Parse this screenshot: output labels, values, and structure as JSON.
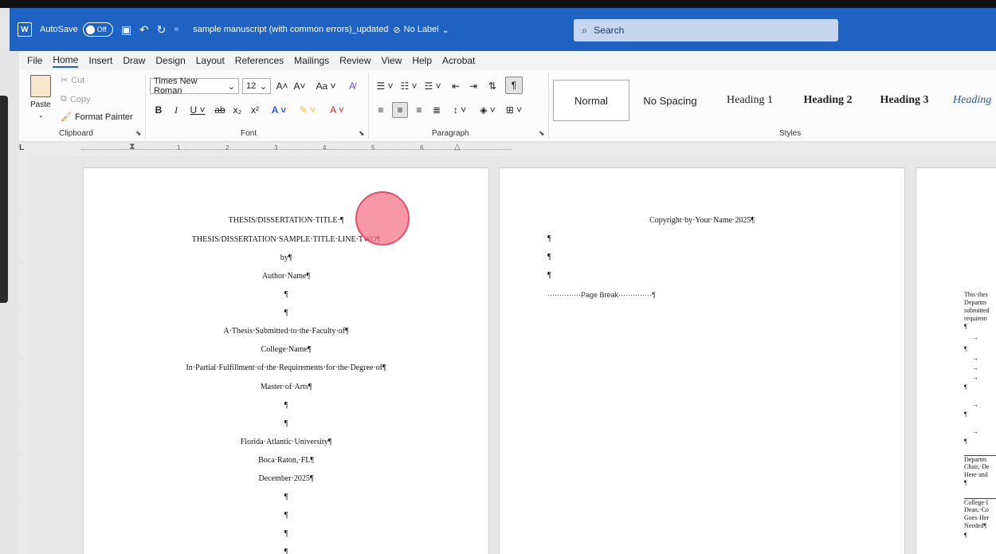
{
  "titlebar": {
    "autosave_label": "AutoSave",
    "autosave_state": "Off",
    "doc_title": "sample manuscript (with common errors)_updated",
    "sensitivity_label": "No Label",
    "search_placeholder": "Search"
  },
  "tabs": [
    "File",
    "Home",
    "Insert",
    "Draw",
    "Design",
    "Layout",
    "References",
    "Mailings",
    "Review",
    "View",
    "Help",
    "Acrobat"
  ],
  "active_tab": "Home",
  "clipboard": {
    "paste": "Paste",
    "cut": "Cut",
    "copy": "Copy",
    "format_painter": "Format Painter",
    "group_label": "Clipboard"
  },
  "font": {
    "family": "Times New Roman",
    "size": "12",
    "group_label": "Font"
  },
  "paragraph": {
    "group_label": "Paragraph"
  },
  "styles": {
    "group_label": "Styles",
    "items": [
      "Normal",
      "No Spacing",
      "Heading 1",
      "Heading 2",
      "Heading 3",
      "Heading"
    ]
  },
  "ruler": {
    "marks": [
      "1",
      "2",
      "3",
      "4",
      "5",
      "6"
    ]
  },
  "page1": {
    "lines": [
      "THESIS/DISSERTATION·TITLE·¶",
      "THESIS/DISSERTATION·SAMPLE·TITLE·LINE·TWO¶",
      "by¶",
      "Author·Name¶",
      "¶",
      "¶",
      "A·Thesis·Submitted·to·the·Faculty·of¶",
      "College·Name¶",
      "In·Partial·Fulfillment·of·the·Requirements·for·the·Degree·of¶",
      "Master·of·Arts¶",
      "¶",
      "¶",
      "Florida·Atlantic·University¶",
      "Boca·Raton,·FL¶",
      "December·2025¶",
      "¶",
      "¶",
      "¶",
      "¶"
    ]
  },
  "page2": {
    "copyright": "Copyright·by·Your·Name·2025¶",
    "pilcrows": [
      "¶",
      "¶",
      "¶"
    ],
    "page_break": "··············Page Break··············¶"
  },
  "page3": {
    "lines": [
      "This·thes",
      "Departm",
      "submitted",
      "requirem",
      "¶",
      "→",
      "¶",
      "→",
      "→",
      "→",
      "¶",
      "→",
      "¶",
      "→",
      "¶",
      "Departm",
      "Chair,·De",
      "Here·and",
      "¶",
      "College·I",
      "Dean,·Co",
      "Goes·Her",
      "Needed¶",
      "¶"
    ]
  }
}
